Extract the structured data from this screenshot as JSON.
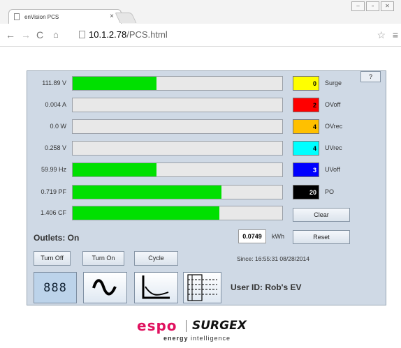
{
  "browser": {
    "tab_title": "enVision PCS",
    "tab_close": "×",
    "url_host": "10.1.2.78",
    "url_path": "/PCS.html"
  },
  "panel": {
    "help_label": "?",
    "rows": [
      {
        "label": "111.89 V",
        "fill": 0.4
      },
      {
        "label": "0.004 A",
        "fill": 0.0
      },
      {
        "label": "0.0 W",
        "fill": 0.0
      },
      {
        "label": "0.258 V",
        "fill": 0.0
      },
      {
        "label": "59.99 Hz",
        "fill": 0.4
      },
      {
        "label": "0.719 PF",
        "fill": 0.71
      },
      {
        "label": "1.406 CF",
        "fill": 0.7
      }
    ],
    "counters": [
      {
        "value": "0",
        "label": "Surge",
        "bg": "#ffff00",
        "fg": "#000000"
      },
      {
        "value": "2",
        "label": "OVoff",
        "bg": "#ff0000",
        "fg": "#000000"
      },
      {
        "value": "4",
        "label": "OVrec",
        "bg": "#ffc000",
        "fg": "#000000"
      },
      {
        "value": "4",
        "label": "UVrec",
        "bg": "#00ffff",
        "fg": "#000000"
      },
      {
        "value": "3",
        "label": "UVoff",
        "bg": "#0000ff",
        "fg": "#ffffff"
      },
      {
        "value": "20",
        "label": "PO",
        "bg": "#000000",
        "fg": "#ffffff"
      }
    ],
    "clear_label": "Clear",
    "reset_label": "Reset",
    "outlets_status": "Outlets: On",
    "kwh_value": "0.0749",
    "kwh_unit": "kWh",
    "since_text": "Since: 16:55:31 08/28/2014",
    "turn_off_label": "Turn Off",
    "turn_on_label": "Turn On",
    "cycle_label": "Cycle",
    "meter_icon_text": "888",
    "user_id": "User ID: Rob's EV"
  },
  "logo": {
    "brand1": "espo",
    "brand2": "SURGEX",
    "tagline_bold": "energy",
    "tagline": " intelligence"
  }
}
